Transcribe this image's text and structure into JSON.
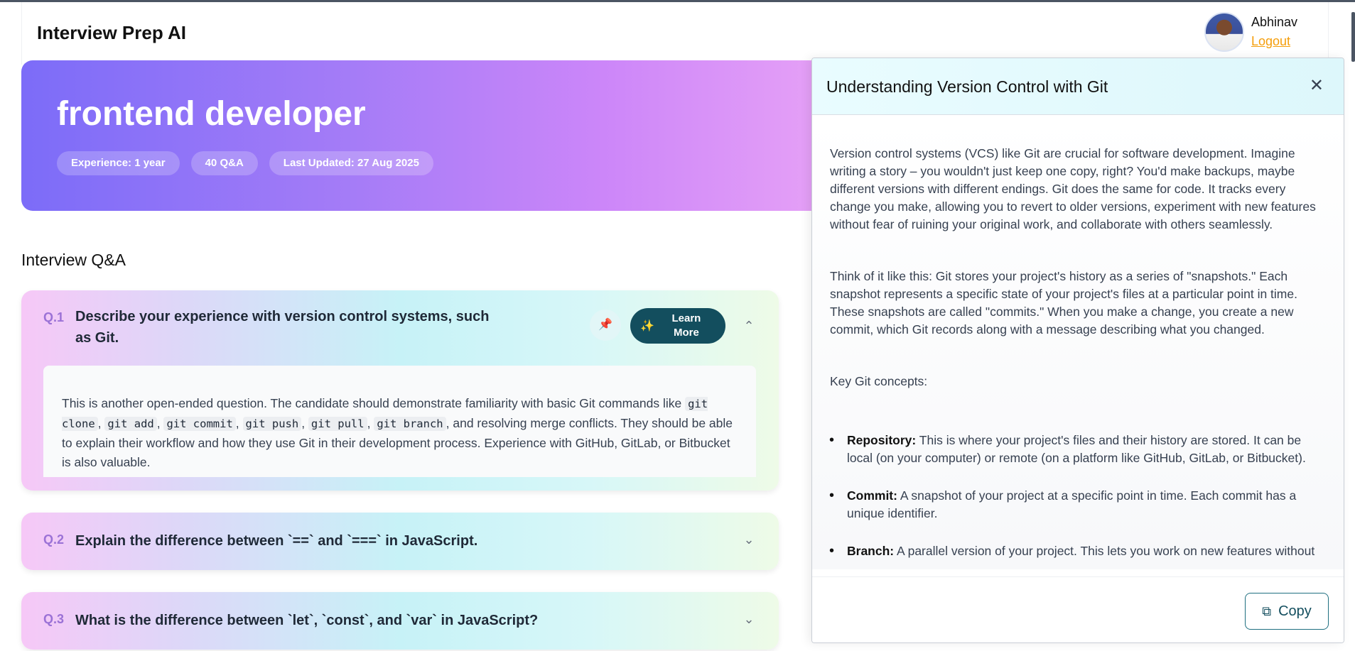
{
  "header": {
    "brand": "Interview Prep AI",
    "user_name": "Abhinav",
    "logout_label": "Logout"
  },
  "hero": {
    "title": "frontend developer",
    "chips": [
      "Experience: 1 year",
      "40 Q&A",
      "Last Updated: 27 Aug 2025"
    ]
  },
  "qa": {
    "heading": "Interview Q&A",
    "questions": [
      {
        "num": "Q.1",
        "text": "Describe your experience with version control systems, such as Git.",
        "expanded": true,
        "learn_more": "Learn More",
        "answer": [
          "This is another open-ended question. The candidate should demonstrate familiarity with basic Git commands like ",
          "git clone",
          ", ",
          "git add",
          ", ",
          "git commit",
          ", ",
          "git push",
          ", ",
          "git pull",
          ", ",
          "git branch",
          ", and resolving merge conflicts. They should be able to explain their workflow and how they use Git in their development process. Experience with GitHub, GitLab, or Bitbucket is also valuable."
        ]
      },
      {
        "num": "Q.2",
        "text": "Explain the difference between `==` and `===` in JavaScript.",
        "expanded": false
      },
      {
        "num": "Q.3",
        "text": "What is the difference between `let`, `const`, and `var` in JavaScript?",
        "expanded": false
      }
    ]
  },
  "drawer": {
    "title": "Understanding Version Control with Git",
    "para1": "Version control systems (VCS) like Git are crucial for software development.  Imagine writing a story – you wouldn't just keep one copy, right? You'd make backups, maybe different versions with different endings.  Git does the same for code.  It tracks every change you make, allowing you to revert to older versions, experiment with new features without fear of ruining your original work, and collaborate with others seamlessly.",
    "para2": "Think of it like this: Git stores your project's history as a series of \"snapshots.\" Each snapshot represents a specific state of your project's files at a particular point in time.  These snapshots are called \"commits.\"  When you make a change, you create a new commit, which Git records along with a message describing what you changed.",
    "para3": "Key Git concepts:",
    "concepts": [
      {
        "term": "Repository:",
        "desc": " This is where your project's files and their history are stored. It can be local (on your computer) or remote (on a platform like GitHub, GitLab, or Bitbucket)."
      },
      {
        "term": "Commit:",
        "desc": " A snapshot of your project at a specific point in time. Each commit has a unique identifier."
      },
      {
        "term": "Branch:",
        "desc": " A parallel version of your project.  This lets you work on new features without"
      }
    ],
    "copy_label": "Copy"
  },
  "icons": {
    "pin": "pin-icon",
    "learn": "sparkle-icon",
    "chevron_up": "chevron-up-icon",
    "chevron_down": "chevron-down-icon",
    "close": "close-icon",
    "copy": "copy-icon"
  },
  "colors": {
    "accent": "#134e5e",
    "logout": "#f59e0b",
    "qnum": "#9b72d6"
  }
}
